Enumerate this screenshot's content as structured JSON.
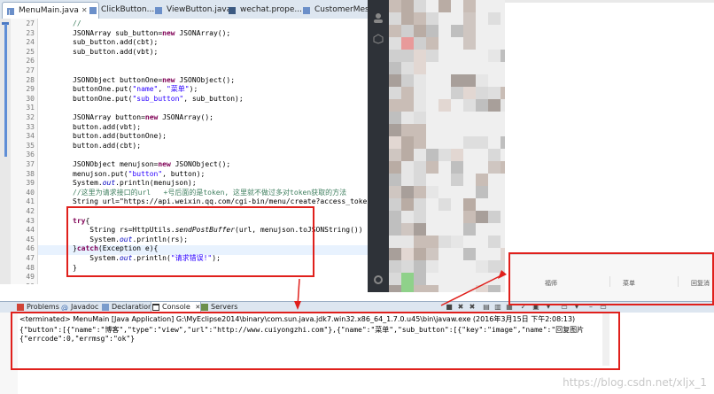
{
  "editor_tabs": [
    {
      "label": "MenuMain.java",
      "active": true,
      "close": "✕"
    },
    {
      "label": "ClickButton...",
      "active": false
    },
    {
      "label": "ViewButton.java",
      "active": false
    },
    {
      "label": "wechat.prope...",
      "active": false
    },
    {
      "label": "CustomerMes...",
      "active": false
    }
  ],
  "editor": {
    "lines": [
      {
        "n": "27",
        "code": "//"
      },
      {
        "n": "23",
        "code": "JSONArray sub_button=new JSONArray();"
      },
      {
        "n": "24",
        "code": "sub_button.add(cbt);"
      },
      {
        "n": "25",
        "code": "sub_button.add(vbt);"
      },
      {
        "n": "26",
        "code": ""
      },
      {
        "n": "27",
        "code": ""
      },
      {
        "n": "28",
        "code": "JSONObject buttonOne=new JSONObject();"
      },
      {
        "n": "29",
        "code": "buttonOne.put(\"name\", \"菜单\");"
      },
      {
        "n": "30",
        "code": "buttonOne.put(\"sub_button\", sub_button);"
      },
      {
        "n": "31",
        "code": ""
      },
      {
        "n": "32",
        "code": "JSONArray button=new JSONArray();"
      },
      {
        "n": "33",
        "code": "button.add(vbt);"
      },
      {
        "n": "34",
        "code": "button.add(buttonOne);"
      },
      {
        "n": "35",
        "code": "button.add(cbt);"
      },
      {
        "n": "36",
        "code": ""
      },
      {
        "n": "37",
        "code": "JSONObject menujson=new JSONObject();"
      },
      {
        "n": "38",
        "code": "menujson.put(\"button\", button);"
      },
      {
        "n": "39",
        "code": "System.out.println(menujson);"
      },
      {
        "n": "40",
        "code": "//这里为请求接口的url   +号后面的是token, 这里就不做过多对token获取的方法"
      },
      {
        "n": "41",
        "code": "String url=\"https://api.weixin.qq.com/cgi-bin/menu/create?access_toke"
      },
      {
        "n": "42",
        "code": ""
      },
      {
        "n": "43",
        "code": "try{"
      },
      {
        "n": "44",
        "code": "    String rs=HttpUtils.sendPostBuffer(url, menujson.toJSONString())"
      },
      {
        "n": "45",
        "code": "    System.out.println(rs);"
      },
      {
        "n": "46",
        "code": "}catch(Exception e){"
      },
      {
        "n": "47",
        "code": "    System.out.println(\"请求错误!\");"
      },
      {
        "n": "48",
        "code": "}"
      },
      {
        "n": "49",
        "code": ""
      },
      {
        "n": "50",
        "code": ""
      }
    ]
  },
  "phone_menu": {
    "items": [
      "福师",
      "菜单",
      "回复消"
    ]
  },
  "console_tabs": [
    {
      "label": "Problems",
      "icon": "problems-icon"
    },
    {
      "label": "Javadoc",
      "icon": "javadoc-icon"
    },
    {
      "label": "Declaration",
      "icon": "declaration-icon"
    },
    {
      "label": "Console",
      "icon": "console-icon",
      "active": true,
      "close": "✕"
    },
    {
      "label": "Servers",
      "icon": "servers-icon"
    }
  ],
  "console": {
    "terminated": "<terminated> MenuMain [Java Application] G:\\MyEclipse2014\\binary\\com.sun.java.jdk7.win32.x86_64_1.7.0.u45\\bin\\javaw.exe (2016年3月15日 下午2:08:13)",
    "line1": "{\"button\":[{\"name\":\"博客\",\"type\":\"view\",\"url\":\"http://www.cuiyongzhi.com\"},{\"name\":\"菜单\",\"sub_button\":[{\"key\":\"image\",\"name\":\"回复图片",
    "line2": "{\"errcode\":0,\"errmsg\":\"ok\"}"
  },
  "watermark": "https://blog.csdn.net/xljx_1",
  "colors": {
    "annotation_red": "#e0201c",
    "keyword": "#7f0055",
    "string": "#2a00ff",
    "comment": "#3f7f5f",
    "field": "#0000c0"
  }
}
